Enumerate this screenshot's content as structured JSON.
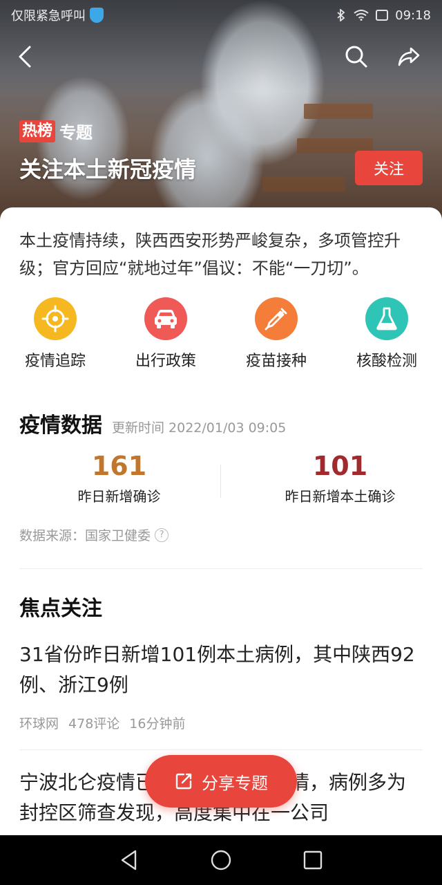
{
  "status_bar": {
    "left_text": "仅限紧急呼叫",
    "time": "09:18"
  },
  "hero": {
    "tag_hot": "热榜",
    "tag_label": "专题",
    "title": "关注本土新冠疫情",
    "follow_label": "关注"
  },
  "summary": "本土疫情持续，陕西西安形势严峻复杂，多项管控升级；官方回应“就地过年”倡议：不能“一刀切”。",
  "categories": [
    {
      "label": "疫情追踪",
      "icon": "crosshair-icon",
      "color": "#f5b820"
    },
    {
      "label": "出行政策",
      "icon": "car-icon",
      "color": "#ef5a57"
    },
    {
      "label": "疫苗接种",
      "icon": "syringe-icon",
      "color": "#f47d3a"
    },
    {
      "label": "核酸检测",
      "icon": "flask-icon",
      "color": "#2ec4b6"
    }
  ],
  "epidemic": {
    "title": "疫情数据",
    "updated": "更新时间 2022/01/03 09:05",
    "stats": [
      {
        "value": "161",
        "label": "昨日新增确诊",
        "color": "#c0762d"
      },
      {
        "value": "101",
        "label": "昨日新增本土确诊",
        "color": "#a02a2e"
      }
    ],
    "source": "数据来源：国家卫健委"
  },
  "focus": {
    "title": "焦点关注",
    "items": [
      {
        "headline": "31省份昨日新增101例本土病例，其中陕西92例、浙江9例",
        "source": "环球网",
        "comments": "478评论",
        "time": "16分钟前"
      },
      {
        "headline": "宁波北仑疫情已发现本轮独立疫情，病例多为封控区筛查发现，高度集中在一公司"
      }
    ]
  },
  "share_label": "分享专题"
}
